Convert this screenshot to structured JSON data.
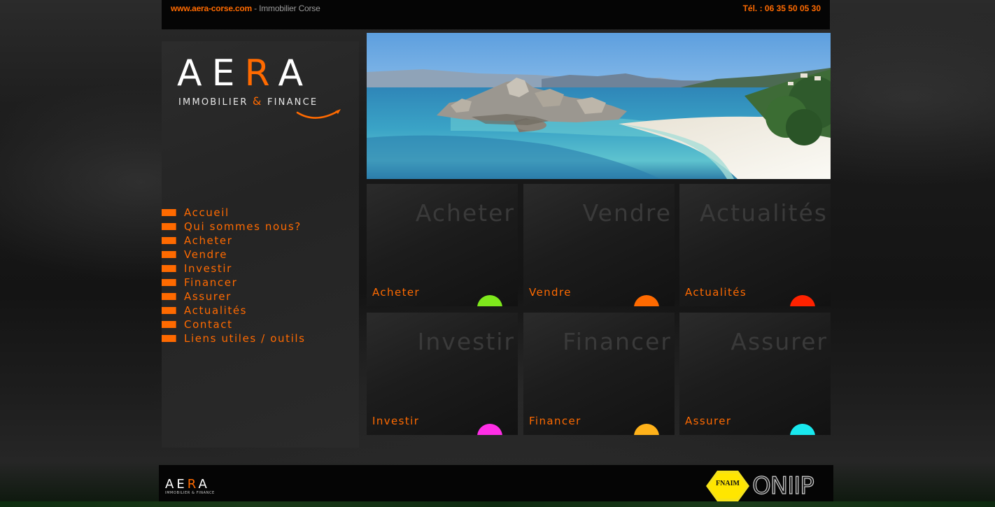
{
  "topbar": {
    "site": "www.aera-corse.com",
    "separator": " - ",
    "tagline": "Immobilier Corse",
    "phone_label": "Tél. : ",
    "phone": "06 35 50 05 30"
  },
  "logo": {
    "word_a": "A",
    "word_e": "E",
    "word_r": "R",
    "word_a2": "A",
    "sub_left": "IMMOBILIER ",
    "sub_amp": "&",
    "sub_right": " FINANCE"
  },
  "nav": {
    "items": [
      {
        "label": "Accueil"
      },
      {
        "label": "Qui sommes nous?"
      },
      {
        "label": "Acheter"
      },
      {
        "label": "Vendre"
      },
      {
        "label": "Investir"
      },
      {
        "label": "Financer"
      },
      {
        "label": "Assurer"
      },
      {
        "label": "Actualités"
      },
      {
        "label": "Contact"
      },
      {
        "label": "Liens utiles / outils"
      }
    ]
  },
  "tiles": [
    {
      "ghost": "Acheter",
      "label": "Acheter",
      "color": "#7ee81c"
    },
    {
      "ghost": "Vendre",
      "label": "Vendre",
      "color": "#ff6a00"
    },
    {
      "ghost": "Actualités",
      "label": "Actualités",
      "color": "#ff2200"
    },
    {
      "ghost": "Investir",
      "label": "Investir",
      "color": "#ff2ee6"
    },
    {
      "ghost": "Financer",
      "label": "Financer",
      "color": "#ffb21a"
    },
    {
      "ghost": "Assurer",
      "label": "Assurer",
      "color": "#19e8ee"
    }
  ],
  "footer": {
    "logo_word_left": "AE",
    "logo_word_r": "R",
    "logo_word_right": "A",
    "logo_sub": "IMMOBILIER & FINANCE",
    "fnaim": "FNAIM",
    "onip": "ONIIP"
  },
  "colors": {
    "accent": "#ff6a00",
    "background": "#1a1a1a"
  }
}
